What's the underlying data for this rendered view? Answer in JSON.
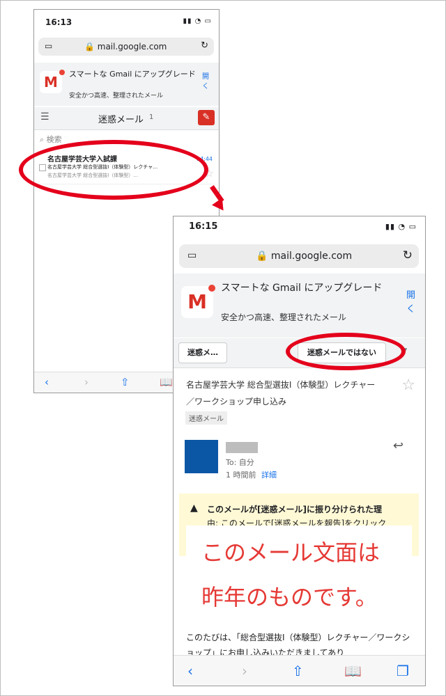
{
  "phone1": {
    "time": "16:13",
    "url": "mail.google.com",
    "promo_title": "スマートな Gmail にアップグレード",
    "promo_sub": "安全かつ高速、整理されたメール",
    "open": "開 く",
    "folder": "迷惑メール",
    "count": "1",
    "search": "検索",
    "message": {
      "from": "名古屋学芸大学入試課",
      "subject": "名古屋学芸大学 総合型選抜I（体験型）レクチャ…",
      "snippet": "名古屋学芸大学 総合型選抜I（体験型）…",
      "time": "14:44"
    }
  },
  "phone2": {
    "time": "16:15",
    "url": "mail.google.com",
    "promo_title": "スマートな Gmail にアップグレード",
    "promo_sub": "安全かつ高速、整理されたメール",
    "open": "開 く",
    "back": "迷惑メ…",
    "not_spam": "迷惑メールではない",
    "subject": "名古屋学芸大学 総合型選抜I（体験型）レクチャー／ワークショップ申し込み",
    "label": "迷惑メール",
    "to": "To: 自分",
    "ago": "1 時間前",
    "detail": "詳細",
    "warning_1": "このメールが[迷惑メール]に振り分けられた理",
    "warning_2": "由: このメールで[迷惑メールを報告]をクリック",
    "overlay_1": "このメール文面は",
    "overlay_2": "昨年のものです。",
    "body": "このたびは、「総合型選抜I（体験型）レクチャー／ワークショップ」にお申し込みいただきましてあり"
  },
  "icons": [
    "tab-icon",
    "lock-icon",
    "reload-icon",
    "menu-icon",
    "compose-icon",
    "search-icon",
    "star-icon",
    "reply-icon",
    "back-icon",
    "forward-icon",
    "share-icon",
    "bookmarks-icon",
    "tabs-icon",
    "warning-icon"
  ],
  "colors": {
    "accent": "#1a73e8",
    "highlight": "#e4001b",
    "avatar": "#0b57a6",
    "warning": "#fff9d6"
  }
}
